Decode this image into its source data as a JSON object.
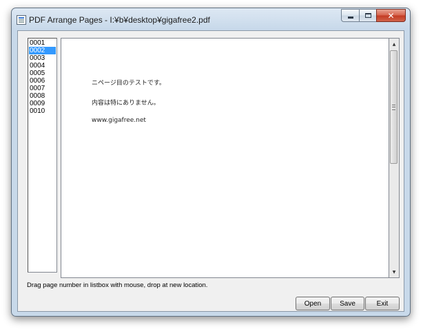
{
  "window": {
    "title": "PDF Arrange Pages - I:¥b¥desktop¥gigafree2.pdf",
    "close_glyph": "✕"
  },
  "pages": {
    "items": [
      "0001",
      "0002",
      "0003",
      "0004",
      "0005",
      "0006",
      "0007",
      "0008",
      "0009",
      "0010"
    ],
    "selected": "0002"
  },
  "preview": {
    "line1": "ニページ目のテストです。",
    "line2": "内容は特にありません。",
    "line3": "www.gigafree.net"
  },
  "scrollbar": {
    "up_arrow": "▲",
    "down_arrow": "▼"
  },
  "hint": "Drag page number in listbox with mouse, drop at new location.",
  "buttons": {
    "open": "Open",
    "save": "Save",
    "exit": "Exit"
  }
}
